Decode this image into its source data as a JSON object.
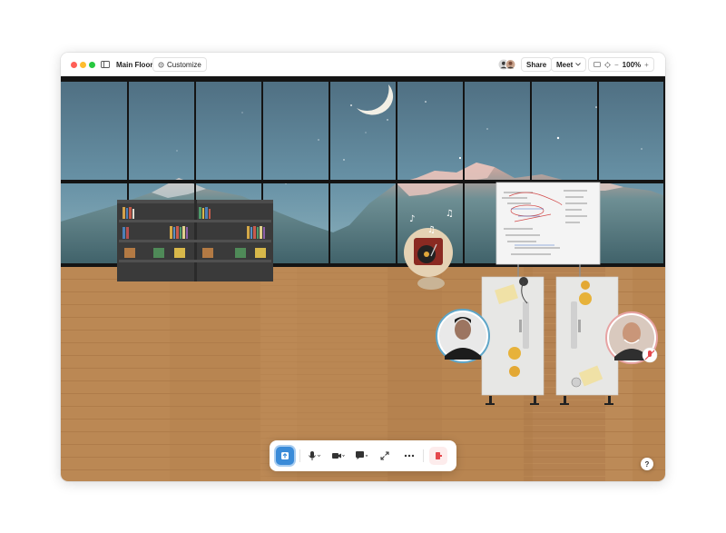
{
  "titlebar": {
    "room_name": "Main Floor",
    "customize_label": "Customize",
    "share_label": "Share",
    "meet_label": "Meet",
    "zoom_level": "100%",
    "zoom_minus": "−",
    "zoom_plus": "+"
  },
  "help": {
    "label": "?"
  },
  "icons": {
    "sidebar": "sidebar-toggle-icon",
    "customize": "gear-icon",
    "upload": "upload-arrow-icon",
    "mic": "microphone-icon",
    "camera": "video-camera-icon",
    "chat": "chat-bubble-icon",
    "expand": "expand-icon",
    "more": "ellipsis-icon",
    "leave": "leave-door-icon",
    "muted": "mic-muted-icon"
  },
  "colors": {
    "close": "#ff5f57",
    "minimize": "#febc2e",
    "zoom": "#28c840",
    "accent": "#3a8bd8",
    "leave": "#e5484d",
    "floor": "#b98552",
    "sky": "#5d8ba3"
  }
}
